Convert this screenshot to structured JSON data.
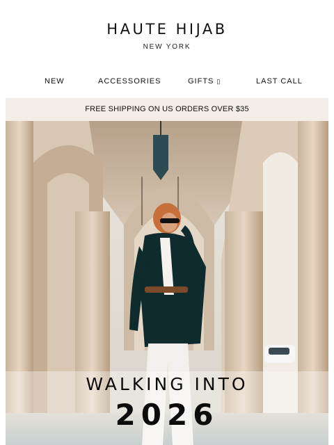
{
  "brand": {
    "name": "HAUTE HIJAB",
    "location": "NEW YORK"
  },
  "nav": {
    "items": [
      {
        "label": "NEW"
      },
      {
        "label": "ACCESSORIES"
      },
      {
        "label": "GIFTS"
      },
      {
        "label": "LAST CALL"
      }
    ]
  },
  "promo_banner": {
    "text": "FREE SHIPPING ON US ORDERS OVER $35"
  },
  "hero": {
    "headline_line1": "WALKING INTO",
    "headline_line2": "2026"
  },
  "colors": {
    "banner_bg": "#f3ece7",
    "text": "#111111"
  }
}
